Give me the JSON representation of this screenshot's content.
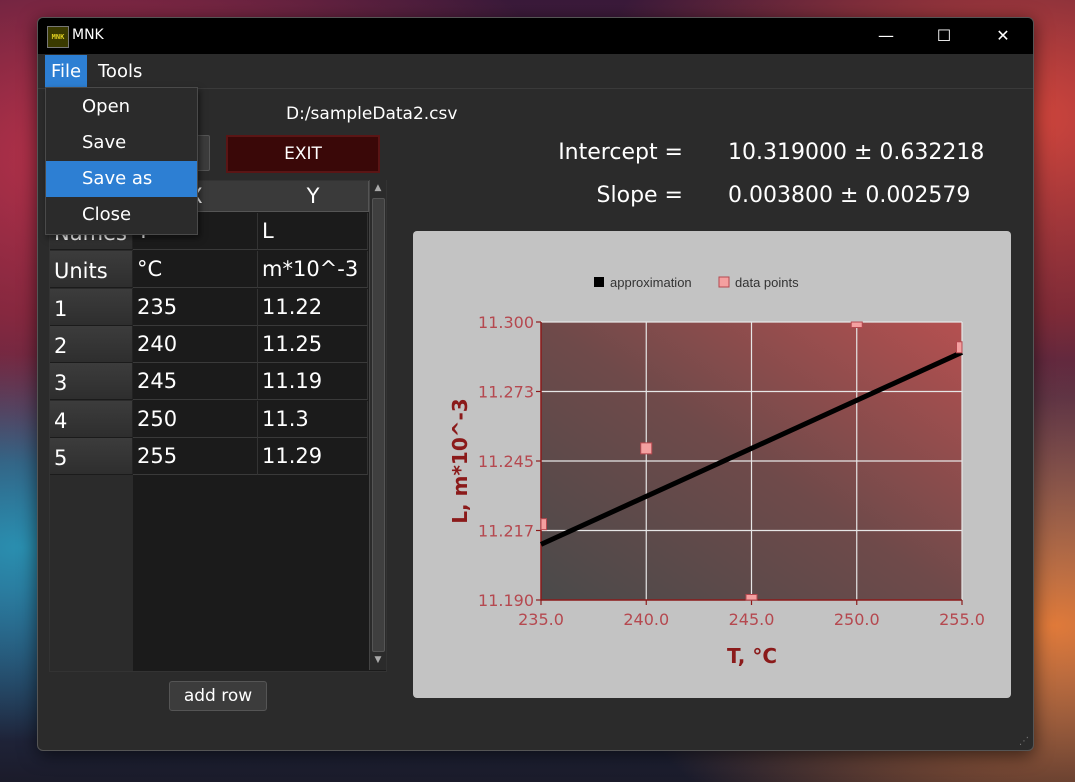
{
  "window": {
    "app_icon_text": "MNK",
    "title": "MNK",
    "controls": [
      "—",
      "☐",
      "✕"
    ]
  },
  "menubar": {
    "file": "File",
    "tools": "Tools"
  },
  "file_menu": {
    "items": [
      {
        "label": "Open"
      },
      {
        "label": "Save"
      },
      {
        "label": "Save as",
        "highlighted": true
      },
      {
        "label": "Close"
      }
    ]
  },
  "file_path": "D:/sampleData2.csv",
  "exit_label": "EXIT",
  "results": {
    "intercept_label": "Intercept =",
    "intercept_value": "10.319000 ± 0.632218",
    "slope_label": "Slope =",
    "slope_value": "0.003800 ± 0.002579"
  },
  "table": {
    "columns": [
      "X",
      "Y"
    ],
    "rows": [
      {
        "head": "Names",
        "x": "T",
        "y": "L"
      },
      {
        "head": "Units",
        "x": "°C",
        "y": "m*10^-3"
      },
      {
        "head": "1",
        "x": "235",
        "y": "11.22"
      },
      {
        "head": "2",
        "x": "240",
        "y": "11.25"
      },
      {
        "head": "3",
        "x": "245",
        "y": "11.19"
      },
      {
        "head": "4",
        "x": "250",
        "y": "11.3"
      },
      {
        "head": "5",
        "x": "255",
        "y": "11.29"
      }
    ]
  },
  "add_row_label": "add row",
  "colors": {
    "accent": "#2d7fd3",
    "axis": "#8b1a1a",
    "tick": "#b5484f",
    "point_fill": "#f4a0a0",
    "line": "#000000",
    "exit_bg": "#3a0808"
  },
  "chart_data": {
    "type": "scatter",
    "legend": {
      "position": "top",
      "entries": [
        "approximation",
        "data points"
      ]
    },
    "xlabel": "T, °C",
    "ylabel": "L, m*10^-3",
    "xlim": [
      235.0,
      255.0
    ],
    "ylim": [
      11.19,
      11.3
    ],
    "x_ticks": [
      "235.0",
      "240.0",
      "245.0",
      "250.0",
      "255.0"
    ],
    "y_ticks": [
      "11.300",
      "11.273",
      "11.245",
      "11.217",
      "11.190"
    ],
    "y_tick_values": [
      11.3,
      11.2725,
      11.245,
      11.2175,
      11.19
    ],
    "grid": true,
    "series": [
      {
        "name": "data points",
        "kind": "points",
        "x": [
          235,
          240,
          245,
          250,
          255
        ],
        "y": [
          11.22,
          11.25,
          11.19,
          11.3,
          11.29
        ]
      },
      {
        "name": "approximation",
        "kind": "line",
        "intercept": 10.319,
        "slope": 0.0038
      }
    ]
  }
}
